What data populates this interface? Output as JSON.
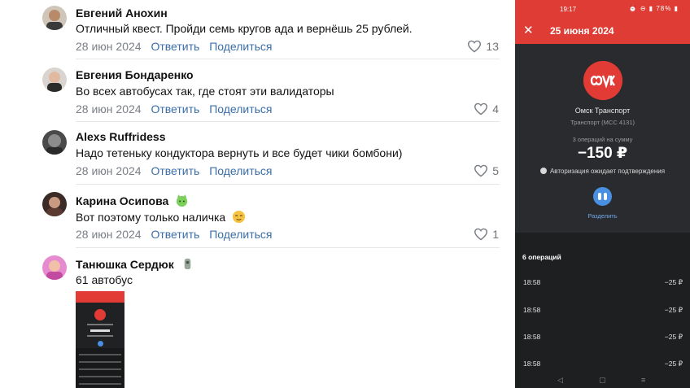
{
  "comments": [
    {
      "author": "Евгений Анохин",
      "text": "Отличный квест. Пройди семь кругов ада и вернёшь 25 рублей.",
      "date": "28 июн 2024",
      "reply": "Ответить",
      "share": "Поделиться",
      "likes": "13"
    },
    {
      "author": "Евгения Бондаренко",
      "text": "Во всех автобусах так, где стоят эти валидаторы",
      "date": "28 июн 2024",
      "reply": "Ответить",
      "share": "Поделиться",
      "likes": "4"
    },
    {
      "author": "Alexs Ruffridess",
      "text": "Надо тетеньку кондуктора вернуть и все будет чики бомбони)",
      "date": "28 июн 2024",
      "reply": "Ответить",
      "share": "Поделиться",
      "likes": "5"
    },
    {
      "author": "Карина Осипова",
      "text": "Вот поэтому только наличка",
      "date": "28 июн 2024",
      "reply": "Ответить",
      "share": "Поделиться",
      "likes": "1"
    },
    {
      "author": "Танюшка Сердюк",
      "text": "61 автобус"
    }
  ],
  "phone": {
    "status_time": "19:17",
    "status_icons": "⏰ ⊖ ▮ 78% ▮",
    "header_date": "25 июня 2024",
    "close_icon": "close-icon",
    "merchant_name": "Омск Транспорт",
    "merchant_category": "Транспорт (MCC 4131)",
    "summary": "3 операций на сумму",
    "amount": "−150 ₽",
    "auth_status": "Авторизация ожидает подтверждения",
    "split_label": "Разделить",
    "ops_title": "6 операций",
    "ops": [
      {
        "time": "18:58",
        "amount": "−25 ₽"
      },
      {
        "time": "18:58",
        "amount": "−25 ₽"
      },
      {
        "time": "18:58",
        "amount": "−25 ₽"
      },
      {
        "time": "18:58",
        "amount": "−25 ₽"
      }
    ],
    "nav": {
      "back": "◁",
      "home": "▢",
      "menu": "≡"
    }
  },
  "colors": {
    "accent": "#de3c34",
    "link": "#3a6ea8",
    "split": "#4a90e2"
  }
}
